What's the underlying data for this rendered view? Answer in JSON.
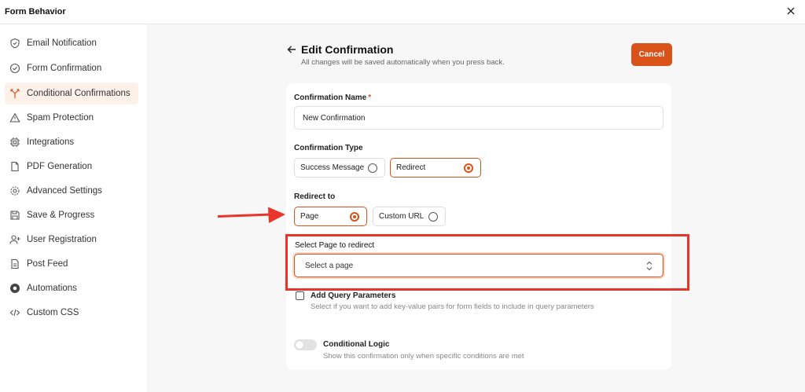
{
  "window": {
    "title": "Form Behavior",
    "close_icon": "close-icon"
  },
  "sidebar": {
    "items": [
      {
        "label": "Email Notification",
        "icon": "shield-icon",
        "active": false
      },
      {
        "label": "Form Confirmation",
        "icon": "check-circle-icon",
        "active": false
      },
      {
        "label": "Conditional Confirmations",
        "icon": "split-arrows-icon",
        "active": true
      },
      {
        "label": "Spam Protection",
        "icon": "warning-triangle-icon",
        "active": false
      },
      {
        "label": "Integrations",
        "icon": "chip-icon",
        "active": false
      },
      {
        "label": "PDF Generation",
        "icon": "document-icon",
        "active": false
      },
      {
        "label": "Advanced Settings",
        "icon": "gear-icon",
        "active": false
      },
      {
        "label": "Save & Progress",
        "icon": "save-icon",
        "active": false
      },
      {
        "label": "User Registration",
        "icon": "user-plus-icon",
        "active": false
      },
      {
        "label": "Post Feed",
        "icon": "file-text-icon",
        "active": false
      },
      {
        "label": "Automations",
        "icon": "automation-icon",
        "active": false
      },
      {
        "label": "Custom CSS",
        "icon": "code-icon",
        "active": false
      }
    ]
  },
  "header": {
    "title": "Edit Confirmation",
    "subtitle": "All changes will be saved automatically when you press back.",
    "cancel_label": "Cancel"
  },
  "form": {
    "name_label": "Confirmation Name",
    "name_required_mark": "*",
    "name_value": "New Confirmation",
    "type_label": "Confirmation Type",
    "type_options": [
      {
        "label": "Success Message",
        "selected": false
      },
      {
        "label": "Redirect",
        "selected": true
      }
    ],
    "redirect_label": "Redirect to",
    "redirect_options": [
      {
        "label": "Page",
        "selected": true
      },
      {
        "label": "Custom URL",
        "selected": false
      }
    ],
    "select_page_label": "Select Page to redirect",
    "select_page_value": "Select a page",
    "query_label": "Add Query Parameters",
    "query_help": "Select if you want to add key-value pairs for form fields to include in query parameters",
    "query_checked": false,
    "logic_label": "Conditional Logic",
    "logic_help": "Show this confirmation only when specific conditions are met",
    "logic_enabled": false
  },
  "colors": {
    "accent": "#d9521a",
    "annotation_red": "#e8342a",
    "active_bg": "#fdf1ea"
  }
}
